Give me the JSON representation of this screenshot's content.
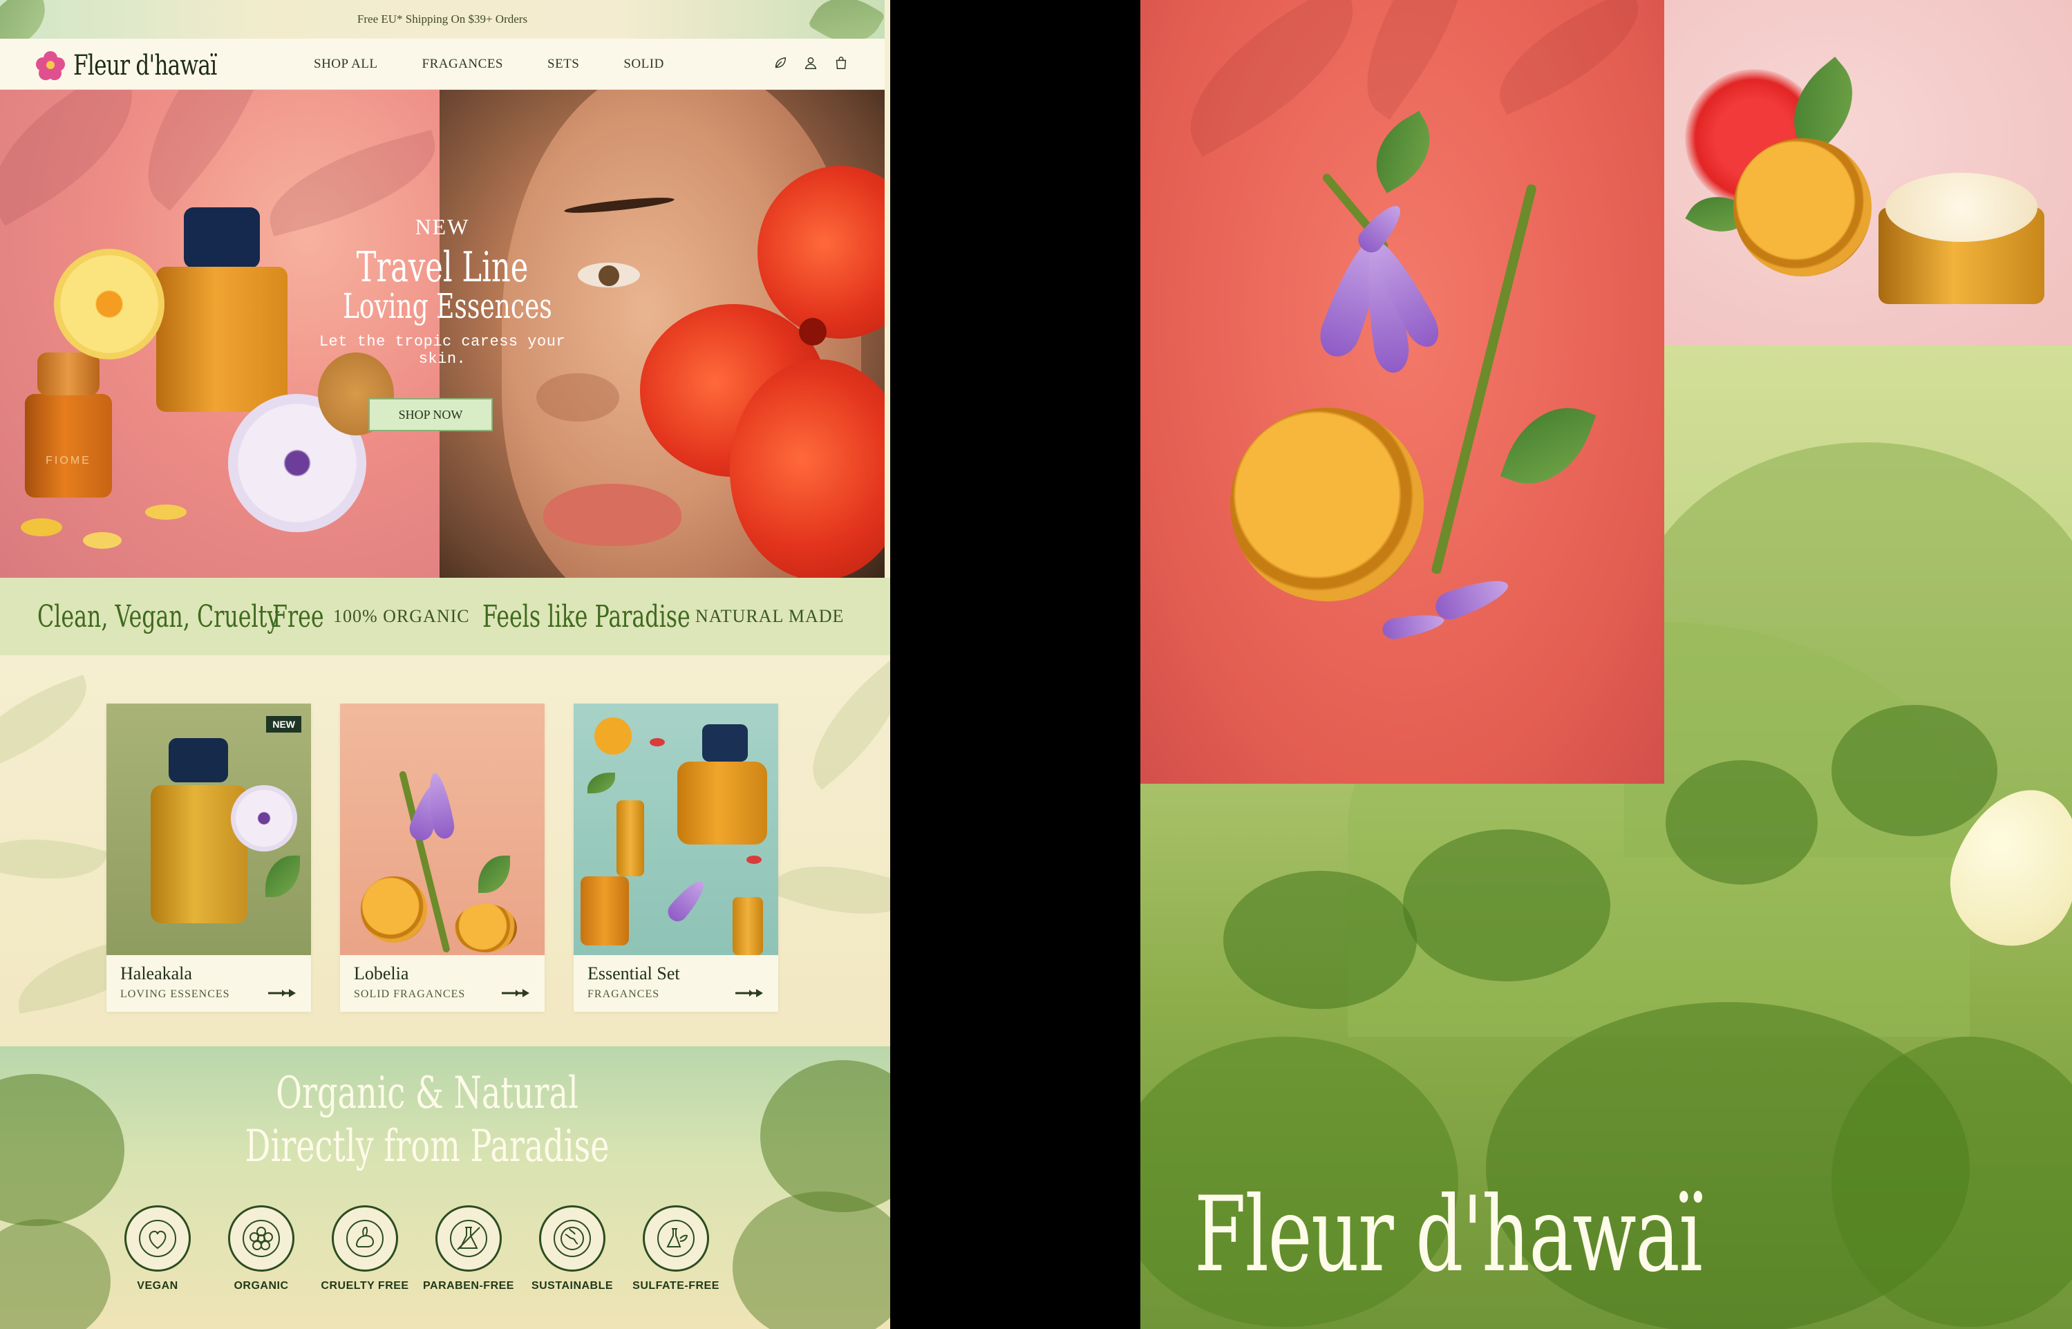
{
  "promo": {
    "text": "Free EU* Shipping On $39+ Orders"
  },
  "brand": {
    "name": "Fleur d'hawaï",
    "accent": "#3f6a1f",
    "pink": "#e0508e"
  },
  "nav": {
    "links": [
      "SHOP ALL",
      "FRAGANCES",
      "SETS",
      "SOLID"
    ],
    "icons": [
      "leaf-icon",
      "user-icon",
      "bag-icon"
    ]
  },
  "hero": {
    "kicker": "NEW",
    "title": "Travel Line",
    "subtitle": "Loving Essences",
    "text": "Let the tropic caress your skin.",
    "cta": "SHOP NOW",
    "bottle_label": "FIOME"
  },
  "ticker": {
    "items": [
      "Clean, Vegan, Cruelty",
      "Free",
      "100% ORGANIC",
      "Feels like Paradise",
      "NATURAL MADE"
    ]
  },
  "products": [
    {
      "name": "Haleakala",
      "category": "LOVING ESSENCES",
      "badge": "NEW"
    },
    {
      "name": "Lobelia",
      "category": "SOLID FRAGANCES",
      "badge": ""
    },
    {
      "name": "Essential Set",
      "category": "FRAGANCES",
      "badge": ""
    }
  ],
  "organic": {
    "line1": "Organic & Natural",
    "line2": "Directly from Paradise",
    "badges": [
      "VEGAN",
      "ORGANIC",
      "CRUELTY FREE",
      "PARABEN-FREE",
      "SUSTAINABLE",
      "SULFATE-FREE"
    ]
  },
  "moodboard": {
    "logo": "Fleur d'hawaï"
  }
}
